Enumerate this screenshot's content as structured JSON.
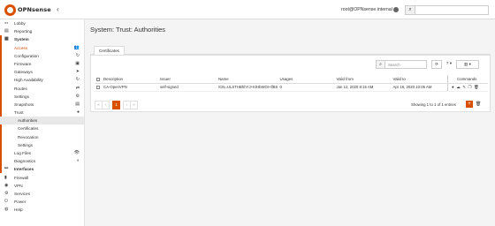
{
  "header": {
    "logo_text": "OPNsense",
    "collapse_glyph": "‹",
    "hostname": "root@OPNsense.internal",
    "search_placeholder": "",
    "search_icon": "search-icon"
  },
  "sidebar": {
    "items": [
      {
        "label": "Lobby",
        "icon": "⚏",
        "level": 0
      },
      {
        "label": "Reporting",
        "icon": "▤",
        "level": 0
      },
      {
        "label": "System",
        "icon": "▦",
        "level": 0
      },
      {
        "label": "Access",
        "icon": "",
        "level": 1,
        "right": "👥"
      },
      {
        "label": "Configuration",
        "icon": "",
        "level": 1,
        "right": "↻"
      },
      {
        "label": "Firmware",
        "icon": "",
        "level": 1,
        "right": "▣"
      },
      {
        "label": "Gateways",
        "icon": "",
        "level": 1,
        "right": "➤"
      },
      {
        "label": "High Availability",
        "icon": "",
        "level": 1,
        "right": "↻"
      },
      {
        "label": "Routes",
        "icon": "",
        "level": 1,
        "right": "⇄"
      },
      {
        "label": "Settings",
        "icon": "",
        "level": 1,
        "right": "⚙"
      },
      {
        "label": "Snapshots",
        "icon": "",
        "level": 1,
        "right": "▤"
      },
      {
        "label": "Trust",
        "icon": "",
        "level": 1,
        "right": "●"
      },
      {
        "label": "Authorities",
        "icon": "",
        "level": 2,
        "right": ""
      },
      {
        "label": "Certificates",
        "icon": "",
        "level": 2,
        "right": ""
      },
      {
        "label": "Revocation",
        "icon": "",
        "level": 2,
        "right": ""
      },
      {
        "label": "Settings",
        "icon": "",
        "level": 2,
        "right": ""
      },
      {
        "label": "Log Files",
        "icon": "",
        "level": 1,
        "right": "👁"
      },
      {
        "label": "Diagnostics",
        "icon": "",
        "level": 1,
        "right": "◐"
      },
      {
        "label": "Interfaces",
        "icon": "⚯",
        "level": 0
      },
      {
        "label": "Firewall",
        "icon": "▮",
        "level": 0
      },
      {
        "label": "VPN",
        "icon": "◉",
        "level": 0
      },
      {
        "label": "Services",
        "icon": "⚙",
        "level": 0
      },
      {
        "label": "Power",
        "icon": "⏻",
        "level": 0
      },
      {
        "label": "Help",
        "icon": "◍",
        "level": 0
      }
    ]
  },
  "main": {
    "page_title": "System: Trust: Authorities",
    "tab_label": "Certificates",
    "toolbar": {
      "search_placeholder": "Search",
      "refresh_glyph": "⟳",
      "rows_label": "7 ▾",
      "columns_label": "▥ ▾"
    },
    "table": {
      "headers": [
        "Description",
        "Issuer",
        "Name",
        "Usages",
        "Valid from",
        "Valid to",
        "Commands"
      ],
      "rows": [
        {
          "description": "CA-OpenVPN",
          "issuer": "self-signed",
          "name": "/CN=ULSTHBhhYJ+KlHbWOI+lfBS",
          "usages": "0",
          "valid_from": "Jan 12, 2020 8:15 AM",
          "valid_to": "Apr 16, 2020 10:05 AM"
        }
      ]
    },
    "pager": [
      "«",
      "‹",
      "1",
      "›",
      "»"
    ],
    "showing": "Showing 1 to 1 of 1 entries",
    "add_glyph": "+",
    "delete_glyph": "🗑"
  }
}
